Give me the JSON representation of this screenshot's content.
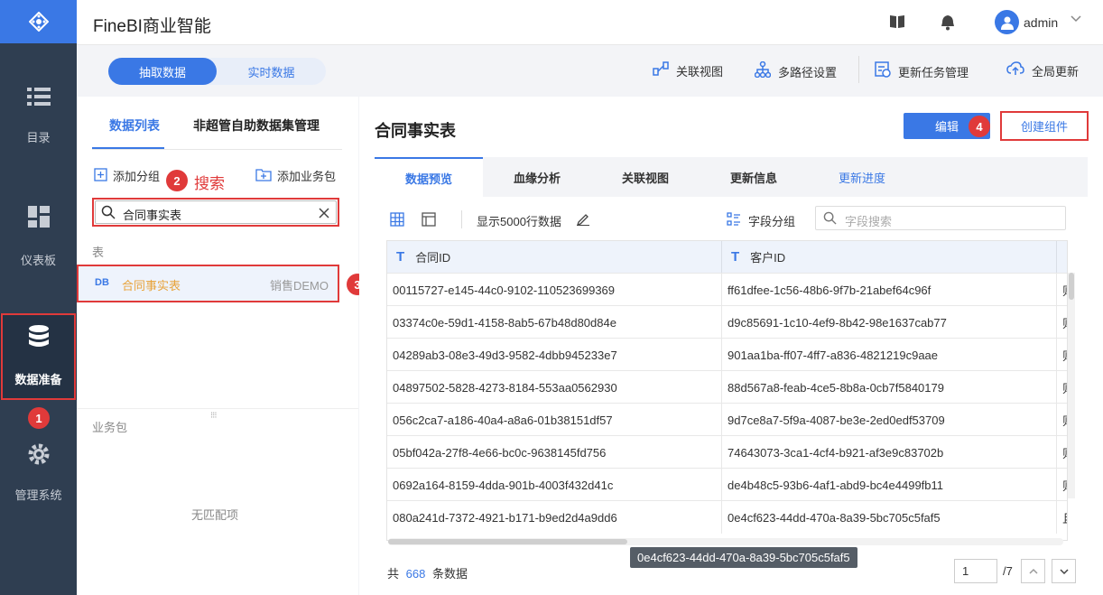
{
  "app": {
    "title": "FineBI商业智能"
  },
  "nav": {
    "items": [
      {
        "label": "目录"
      },
      {
        "label": "仪表板"
      },
      {
        "label": "数据准备"
      },
      {
        "label": "管理系统"
      }
    ]
  },
  "header": {
    "username": "admin"
  },
  "toolbar": {
    "segment": [
      "抽取数据",
      "实时数据"
    ],
    "actions": [
      "关联视图",
      "多路径设置",
      "更新任务管理",
      "全局更新"
    ]
  },
  "left_panel": {
    "tabs": [
      "数据列表",
      "非超管自助数据集管理"
    ],
    "add_group": "添加分组",
    "add_package": "添加业务包",
    "search_value": "合同事实表",
    "section_label": "表",
    "table_item": {
      "type": "DB",
      "name": "合同事实表",
      "package": "销售DEMO"
    },
    "package_label": "业务包",
    "no_match": "无匹配项"
  },
  "annotations": {
    "b1": "1",
    "b2": "2",
    "b3": "3",
    "b4": "4",
    "search_text": "搜索"
  },
  "right_panel": {
    "title": "合同事实表",
    "edit_button": "编辑",
    "create_button": "创建组件",
    "tabs": [
      "数据预览",
      "血缘分析",
      "关联视图",
      "更新信息",
      "更新进度"
    ],
    "show_rows": "显示5000行数据",
    "field_group": "字段分组",
    "field_search_placeholder": "字段搜索",
    "columns": [
      "合同ID",
      "客户ID"
    ],
    "rows": [
      [
        "00115727-e145-44c0-9102-110523699369",
        "ff61dfee-1c56-48b6-9f7b-21abef64c96f",
        "则"
      ],
      [
        "03374c0e-59d1-4158-8ab5-67b48d80d84e",
        "d9c85691-1c10-4ef9-8b42-98e1637cab77",
        "则"
      ],
      [
        "04289ab3-08e3-49d3-9582-4dbb945233e7",
        "901aa1ba-ff07-4ff7-a836-4821219c9aae",
        "则"
      ],
      [
        "04897502-5828-4273-8184-553aa0562930",
        "88d567a8-feab-4ce5-8b8a-0cb7f5840179",
        "则"
      ],
      [
        "056c2ca7-a186-40a4-a8a6-01b38151df57",
        "9d7ce8a7-5f9a-4087-be3e-2ed0edf53709",
        "则"
      ],
      [
        "05bf042a-27f8-4e66-bc0c-9638145fd756",
        "74643073-3ca1-4cf4-b921-af3e9c83702b",
        "则"
      ],
      [
        "0692a164-8159-4dda-901b-4003f432d41c",
        "de4b48c5-93b6-4af1-abd9-bc4e4499fb11",
        "则"
      ],
      [
        "080a241d-7372-4921-b171-b9ed2d4a9dd6",
        "0e4cf623-44dd-470a-8a39-5bc705c5faf5",
        "且"
      ]
    ],
    "tooltip": "0e4cf623-44dd-470a-8a39-5bc705c5faf5",
    "footer": {
      "prefix": "共",
      "count": "668",
      "suffix": "条数据",
      "page": "1",
      "total_pages": "/7"
    }
  }
}
